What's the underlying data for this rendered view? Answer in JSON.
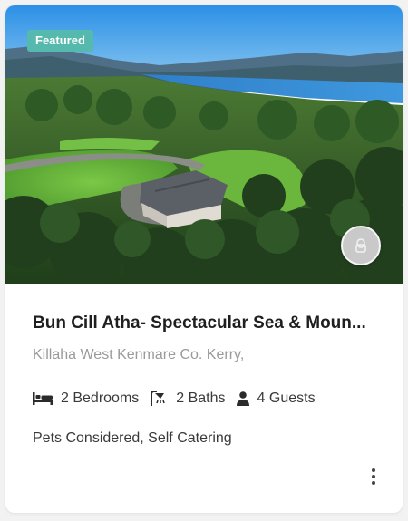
{
  "listing": {
    "badge": "Featured",
    "title": "Bun Cill Atha- Spectacular Sea & Moun...",
    "address": "Killaha West Kenmare Co. Kerry,",
    "amenities": {
      "bedrooms": "2 Bedrooms",
      "baths": "2 Baths",
      "guests": "4 Guests"
    },
    "tags": "Pets Considered, Self Catering"
  },
  "icons": {
    "bed": "bed-icon",
    "bath": "shower-icon",
    "guests": "user-icon",
    "avatar": "user-avatar-icon",
    "more": "more-vertical-icon"
  },
  "colors": {
    "badge_bg": "#55b9ad",
    "title": "#1f1f1f",
    "muted": "#9a9a9a"
  }
}
